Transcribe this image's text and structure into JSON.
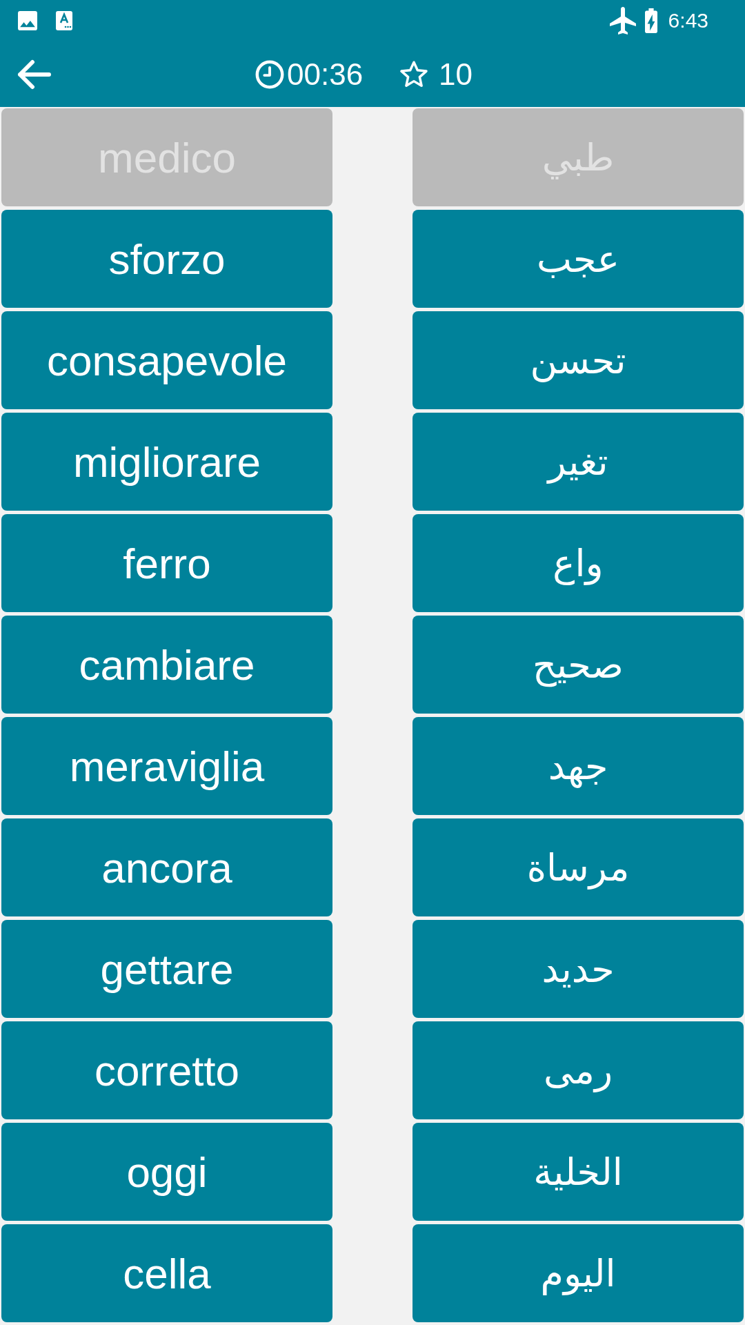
{
  "status_bar": {
    "time": "6:43"
  },
  "header": {
    "timer": "00:36",
    "score": "10"
  },
  "rows": [
    {
      "left": {
        "word": "medico",
        "disabled": true
      },
      "right": {
        "word": "طبي",
        "disabled": true
      }
    },
    {
      "left": {
        "word": "sforzo",
        "disabled": false
      },
      "right": {
        "word": "عجب",
        "disabled": false
      }
    },
    {
      "left": {
        "word": "consapevole",
        "disabled": false
      },
      "right": {
        "word": "تحسن",
        "disabled": false
      }
    },
    {
      "left": {
        "word": "migliorare",
        "disabled": false
      },
      "right": {
        "word": "تغير",
        "disabled": false
      }
    },
    {
      "left": {
        "word": "ferro",
        "disabled": false
      },
      "right": {
        "word": "واع",
        "disabled": false
      }
    },
    {
      "left": {
        "word": "cambiare",
        "disabled": false
      },
      "right": {
        "word": "صحيح",
        "disabled": false
      }
    },
    {
      "left": {
        "word": "meraviglia",
        "disabled": false
      },
      "right": {
        "word": "جهد",
        "disabled": false
      }
    },
    {
      "left": {
        "word": "ancora",
        "disabled": false
      },
      "right": {
        "word": "مرساة",
        "disabled": false
      }
    },
    {
      "left": {
        "word": "gettare",
        "disabled": false
      },
      "right": {
        "word": "حديد",
        "disabled": false
      }
    },
    {
      "left": {
        "word": "corretto",
        "disabled": false
      },
      "right": {
        "word": "رمى",
        "disabled": false
      }
    },
    {
      "left": {
        "word": "oggi",
        "disabled": false
      },
      "right": {
        "word": "الخلية",
        "disabled": false
      }
    },
    {
      "left": {
        "word": "cella",
        "disabled": false
      },
      "right": {
        "word": "اليوم",
        "disabled": false
      }
    }
  ]
}
